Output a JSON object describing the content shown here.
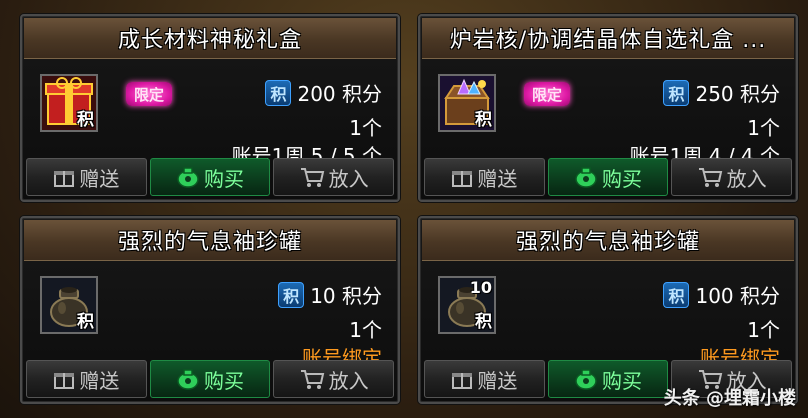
{
  "cards": [
    {
      "title": "成长材料神秘礼盒",
      "badge": "限定",
      "price_icon": "积",
      "price": "200 积分",
      "quantity": "1个",
      "limit": "账号1周 5 / 5 个",
      "item_mark": "积",
      "icon_name": "red-gift-box-icon",
      "buttons": {
        "gift": "赠送",
        "buy": "购买",
        "put": "放入"
      }
    },
    {
      "title": "炉岩核/协调结晶体自选礼盒 ...",
      "badge": "限定",
      "price_icon": "积",
      "price": "250 积分",
      "quantity": "1个",
      "limit": "账号1周 4 / 4 个",
      "item_mark": "积",
      "icon_name": "crystal-chest-icon",
      "buttons": {
        "gift": "赠送",
        "buy": "购买",
        "put": "放入"
      }
    },
    {
      "title": "强烈的气息袖珍罐",
      "price_icon": "积",
      "price": "10 积分",
      "quantity": "1个",
      "limit": "账号绑定",
      "item_mark": "积",
      "icon_name": "pot-icon",
      "buttons": {
        "gift": "赠送",
        "buy": "购买",
        "put": "放入"
      }
    },
    {
      "title": "强烈的气息袖珍罐",
      "price_icon": "积",
      "price": "100 积分",
      "quantity": "1个",
      "limit": "账号绑定",
      "item_mark": "积",
      "stack_count": "10",
      "icon_name": "pot-icon",
      "buttons": {
        "gift": "赠送",
        "buy": "购买",
        "put": "放入"
      }
    }
  ],
  "watermark": "头条 @埋霜小楼",
  "colors": {
    "header": "#4a3724",
    "badge": "#e01aa6",
    "bound_text": "#ff9a1f",
    "buy_button": "#0b3d1d"
  }
}
